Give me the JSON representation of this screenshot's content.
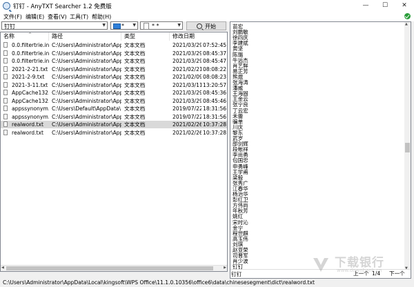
{
  "window": {
    "title": "钉钉 - AnyTXT Searcher 1.2 免费版",
    "minimize": "—",
    "maximize": "☐",
    "close": "✕"
  },
  "menu": [
    "文件(F)",
    "编辑(E)",
    "查看(V)",
    "工具(T)",
    "帮助(H)"
  ],
  "toolbar": {
    "search_value": "钉钉",
    "file_type_value": "*",
    "ext_value": "* *",
    "start_label": "开始"
  },
  "columns": {
    "name": "名称",
    "path": "路径",
    "type": "类型",
    "date": "修改日期"
  },
  "rows": [
    {
      "name": "0.0.filtertrie.in...",
      "path": "C:\\Users\\Administrator\\App...",
      "type": "文本文档",
      "date": "2021/03/29",
      "time": "07:52:45",
      "selected": false
    },
    {
      "name": "0.0.filtertrie.in...",
      "path": "C:\\Users\\Administrator\\App...",
      "type": "文本文档",
      "date": "2021/03/29",
      "time": "08:45:37",
      "selected": false
    },
    {
      "name": "0.0.filtertrie.in...",
      "path": "C:\\Users\\Administrator\\App...",
      "type": "文本文档",
      "date": "2021/03/29",
      "time": "08:45:47",
      "selected": false
    },
    {
      "name": "2021-2-21.txt",
      "path": "C:\\Users\\Administrator\\App...",
      "type": "文本文档",
      "date": "2021/02/21",
      "time": "08:08:22",
      "selected": false
    },
    {
      "name": "2021-2-9.txt",
      "path": "C:\\Users\\Administrator\\App...",
      "type": "文本文档",
      "date": "2021/02/09",
      "time": "08:08:23",
      "selected": false
    },
    {
      "name": "2021-3-11.txt",
      "path": "C:\\Users\\Administrator\\App...",
      "type": "文本文档",
      "date": "2021/03/11",
      "time": "13:20:57",
      "selected": false
    },
    {
      "name": "AppCache132...",
      "path": "C:\\Users\\Administrator\\App...",
      "type": "文本文档",
      "date": "2021/03/29",
      "time": "08:45:36",
      "selected": false
    },
    {
      "name": "AppCache132...",
      "path": "C:\\Users\\Administrator\\App...",
      "type": "文本文档",
      "date": "2021/03/29",
      "time": "08:45:46",
      "selected": false
    },
    {
      "name": "appssynonym...",
      "path": "C:\\Users\\Default\\AppData\\...",
      "type": "文本文档",
      "date": "2019/07/22",
      "time": "18:31:56",
      "selected": false
    },
    {
      "name": "appssynonym...",
      "path": "C:\\Users\\Administrator\\App...",
      "type": "文本文档",
      "date": "2019/07/22",
      "time": "18:31:56",
      "selected": false
    },
    {
      "name": "realword.txt",
      "path": "C:\\Users\\Administrator\\App...",
      "type": "文本文档",
      "date": "2021/02/26",
      "time": "10:37:28",
      "selected": true
    },
    {
      "name": "realword.txt",
      "path": "C:\\Users\\Administrator\\App...",
      "type": "文本文档",
      "date": "2021/02/26",
      "time": "10:37:28",
      "selected": false
    }
  ],
  "preview_lines": [
    "苗宏",
    "刘鹏敏",
    "徐四庆",
    "李建斌",
    "黄坚",
    "陈璐",
    "牛远杰",
    "肖艺鲜",
    "易正芳",
    "熊焜",
    "张海涛",
    "潘威",
    "王海固",
    "王金云",
    "张宁良",
    "丁云宏",
    "禾蕾",
    "骗单",
    "川庆",
    "黎东",
    "武岁",
    "邵剑辉",
    "段帐祥",
    "李尚勇",
    "包国忠",
    "申勇峰",
    "王学甫",
    "梁毅",
    "张秀广",
    "江春华",
    "杨治华",
    "彭红卫",
    "方伟尚",
    "年秋芳",
    "姚红",
    "宋时沁",
    "金宁",
    "程世麒",
    "高玉伟",
    "刘琪",
    "赵亚荣",
    "司晋军",
    "肖少波",
    "钉钉"
  ],
  "find_value": "钉钉",
  "pager": {
    "prev": "上一个",
    "position": "1/4",
    "next": "下一个"
  },
  "status_path": "C:\\Users\\Administrator\\AppData\\Local\\kingsoft\\WPS Office\\11.1.0.10356\\office6\\data\\chinesesegment\\dict\\realword.txt",
  "watermark": {
    "text": "下载银行",
    "sub": "www.downbank.cn"
  }
}
